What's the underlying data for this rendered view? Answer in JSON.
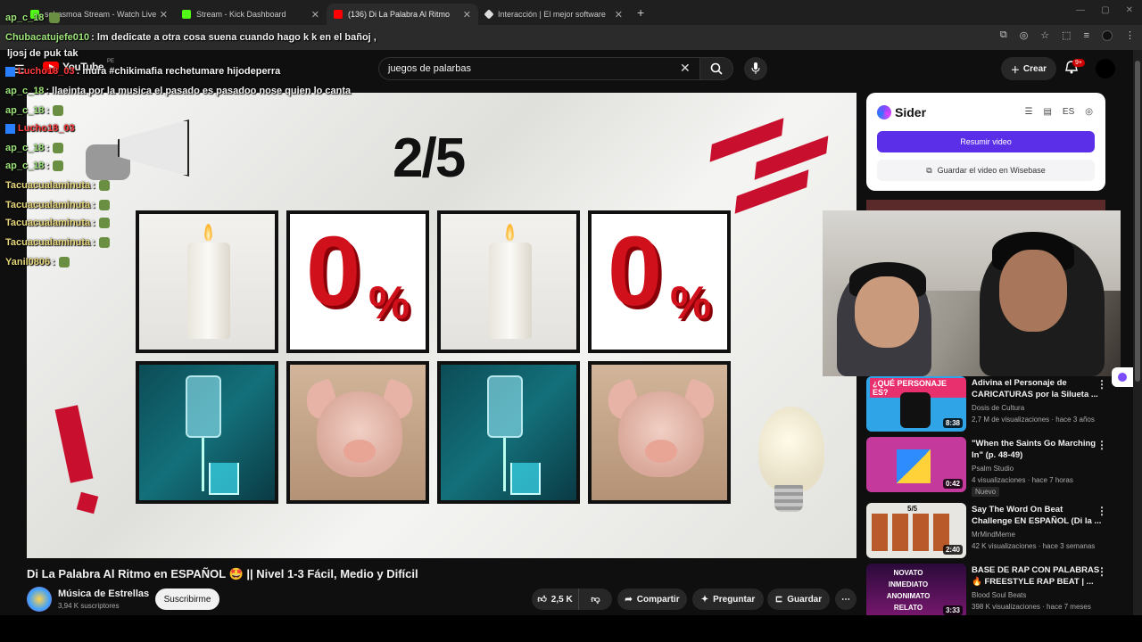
{
  "browser": {
    "tabs": [
      {
        "title": "sebasmoa Stream - Watch Live",
        "color": "#53fc18",
        "active": false
      },
      {
        "title": "Stream - Kick Dashboard",
        "color": "#53fc18",
        "active": false
      },
      {
        "title": "(136) Di La Palabra Al Ritmo",
        "color": "#ff0000",
        "active": true
      },
      {
        "title": "Interacción | El mejor software",
        "color": "#dddddd",
        "active": false
      }
    ],
    "new_tab": "+"
  },
  "youtube": {
    "logo": "YouTube",
    "country": "PE",
    "search_value": "juegos de palarbas",
    "create_label": "Crear",
    "notif_badge": "9+",
    "video": {
      "counter": "2/5",
      "words": [
        "candle",
        "zero-percent",
        "candle",
        "zero-percent",
        "iv-bag",
        "pig",
        "iv-bag",
        "pig"
      ],
      "title": "Di La Palabra Al Ritmo en ESPAÑOL 🤩 || Nivel 1-3 Fácil, Medio y Difícil",
      "channel": "Música de Estrellas",
      "subs": "3,94 K suscriptores",
      "subscribe": "Suscribirme",
      "likes": "2,5 K",
      "share": "Compartir",
      "ask": "Preguntar",
      "save": "Guardar"
    },
    "recommendations": [
      {
        "title": "Adivina el Personaje de CARICATURAS por la Silueta ...",
        "channel": "Dosis de Cultura",
        "meta": "2,7 M de visualizaciones · hace 3 años",
        "duration": "8:38",
        "thumb_text": "¿QUÉ PERSONAJE ES?",
        "badge": ""
      },
      {
        "title": "\"When the Saints Go Marching In\" (p. 48-49)",
        "channel": "Psalm Studio",
        "meta": "4 visualizaciones · hace 7 horas",
        "duration": "0:42",
        "thumb_text": "",
        "badge": "Nuevo"
      },
      {
        "title": "Say The Word On Beat Challenge EN ESPAÑOL (Di la ...",
        "channel": "MrMindMeme",
        "meta": "42 K visualizaciones · hace 3 semanas",
        "duration": "2:40",
        "thumb_text": "5/5",
        "badge": ""
      },
      {
        "title": "BASE DE RAP CON PALABRAS 🔥 FREESTYLE RAP BEAT | ...",
        "channel": "Blood Soul Beats",
        "meta": "398 K visualizaciones · hace 7 meses",
        "duration": "3:33",
        "thumb_text": "NOVATO INMEDIATO ANONIMATO RELATO",
        "badge": ""
      }
    ]
  },
  "sider": {
    "title": "Sider",
    "lang": "ES",
    "summarize": "Resumir video",
    "save": "Guardar el video en Wisebase"
  },
  "chat": [
    {
      "user": "ap_c_18",
      "text": "",
      "emote": true,
      "color": "green"
    },
    {
      "user": "Chubacatujefe010",
      "text": ": lm dedicate a otra cosa suena cuando hago k k en el bañoj ,",
      "emote": false,
      "color": "green"
    },
    {
      "user": "",
      "text": "ljosj de puk tak",
      "emote": false,
      "color": "white"
    },
    {
      "user": "Lucho18_03",
      "text": ": mura #chikimafia rechetumare hijodeperra",
      "emote": false,
      "color": "red"
    },
    {
      "user": "ap_c_18",
      "text": ": llaeinta por la musica el pasado es pasadoo nose quien lo canta",
      "emote": false,
      "color": "green"
    },
    {
      "user": "ap_c_18",
      "text": ":",
      "emote": true,
      "color": "green"
    },
    {
      "user": "Lucho18_03",
      "text": "",
      "emote": false,
      "color": "red"
    },
    {
      "user": "ap_c_18",
      "text": ":",
      "emote": true,
      "color": "green"
    },
    {
      "user": "ap_c_18",
      "text": ":",
      "emote": true,
      "color": "green"
    },
    {
      "user": "Tacuacualaminuta",
      "text": ":",
      "emote": true,
      "color": "yellow"
    },
    {
      "user": "Tacuacualaminuta",
      "text": ":",
      "emote": true,
      "color": "yellow"
    },
    {
      "user": "Tacuacualaminuta",
      "text": ":",
      "emote": true,
      "color": "yellow"
    },
    {
      "user": "Tacuacualaminuta",
      "text": ":",
      "emote": true,
      "color": "yellow"
    },
    {
      "user": "Yanil0806",
      "text": ":",
      "emote": true,
      "color": "yellow"
    }
  ]
}
